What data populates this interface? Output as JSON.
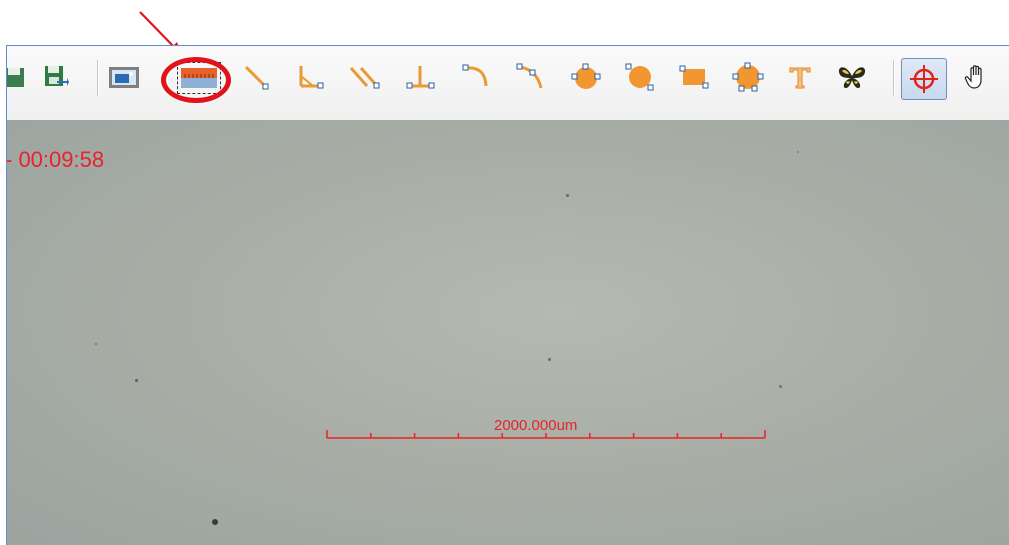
{
  "annotation": {
    "color": "#e1121b",
    "target": "scale-bar-button"
  },
  "toolbar": {
    "buttons": [
      {
        "id": "partial-save",
        "icon": "save-icon"
      },
      {
        "id": "save-as",
        "icon": "floppy-arrow-icon"
      },
      {
        "id": "snapshot",
        "icon": "image-frame-icon"
      },
      {
        "id": "scale-bar",
        "icon": "ruler-scale-icon"
      },
      {
        "id": "line",
        "icon": "line-icon"
      },
      {
        "id": "angle",
        "icon": "angle-icon"
      },
      {
        "id": "parallel-lines",
        "icon": "parallel-lines-icon"
      },
      {
        "id": "perpendicular",
        "icon": "perpendicular-icon"
      },
      {
        "id": "arc",
        "icon": "arc-icon"
      },
      {
        "id": "arc-3pt",
        "icon": "arc-3-point-icon"
      },
      {
        "id": "circle-3pt",
        "icon": "circle-3-point-icon"
      },
      {
        "id": "circle-radius",
        "icon": "circle-radius-icon"
      },
      {
        "id": "rectangle",
        "icon": "rectangle-icon"
      },
      {
        "id": "polygon",
        "icon": "polygon-icon"
      },
      {
        "id": "text",
        "icon": "text-tool-icon"
      },
      {
        "id": "butterfly",
        "icon": "butterfly-icon"
      },
      {
        "id": "crosshair",
        "icon": "crosshair-icon",
        "active": true
      },
      {
        "id": "hand",
        "icon": "hand-pan-icon"
      }
    ]
  },
  "viewport": {
    "timestamp": "- 00:09:58",
    "scale_bar": {
      "label": "2000.000um",
      "color": "#e8232a",
      "divisions": 10
    }
  }
}
